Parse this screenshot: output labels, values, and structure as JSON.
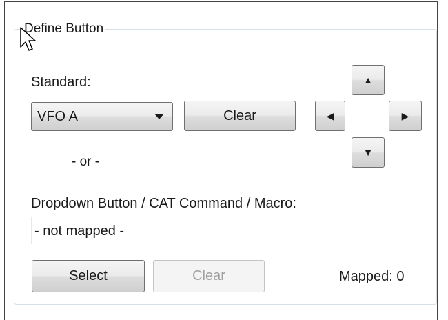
{
  "group": {
    "title": "Define Button"
  },
  "standard": {
    "label": "Standard:",
    "selected": "VFO A",
    "clear_label": "Clear",
    "or_label": "- or -"
  },
  "arrows": {
    "up": "up-arrow-icon",
    "down": "down-arrow-icon",
    "left": "left-arrow-icon",
    "right": "right-arrow-icon"
  },
  "mapping": {
    "label": "Dropdown Button / CAT Command / Macro:",
    "value": "- not mapped -",
    "select_label": "Select",
    "clear_label": "Clear",
    "mapped_text": "Mapped: 0"
  },
  "colors": {
    "groupbox_border": "#d5dfe5",
    "button_border": "#707070",
    "disabled_text": "#a0a0a0"
  }
}
